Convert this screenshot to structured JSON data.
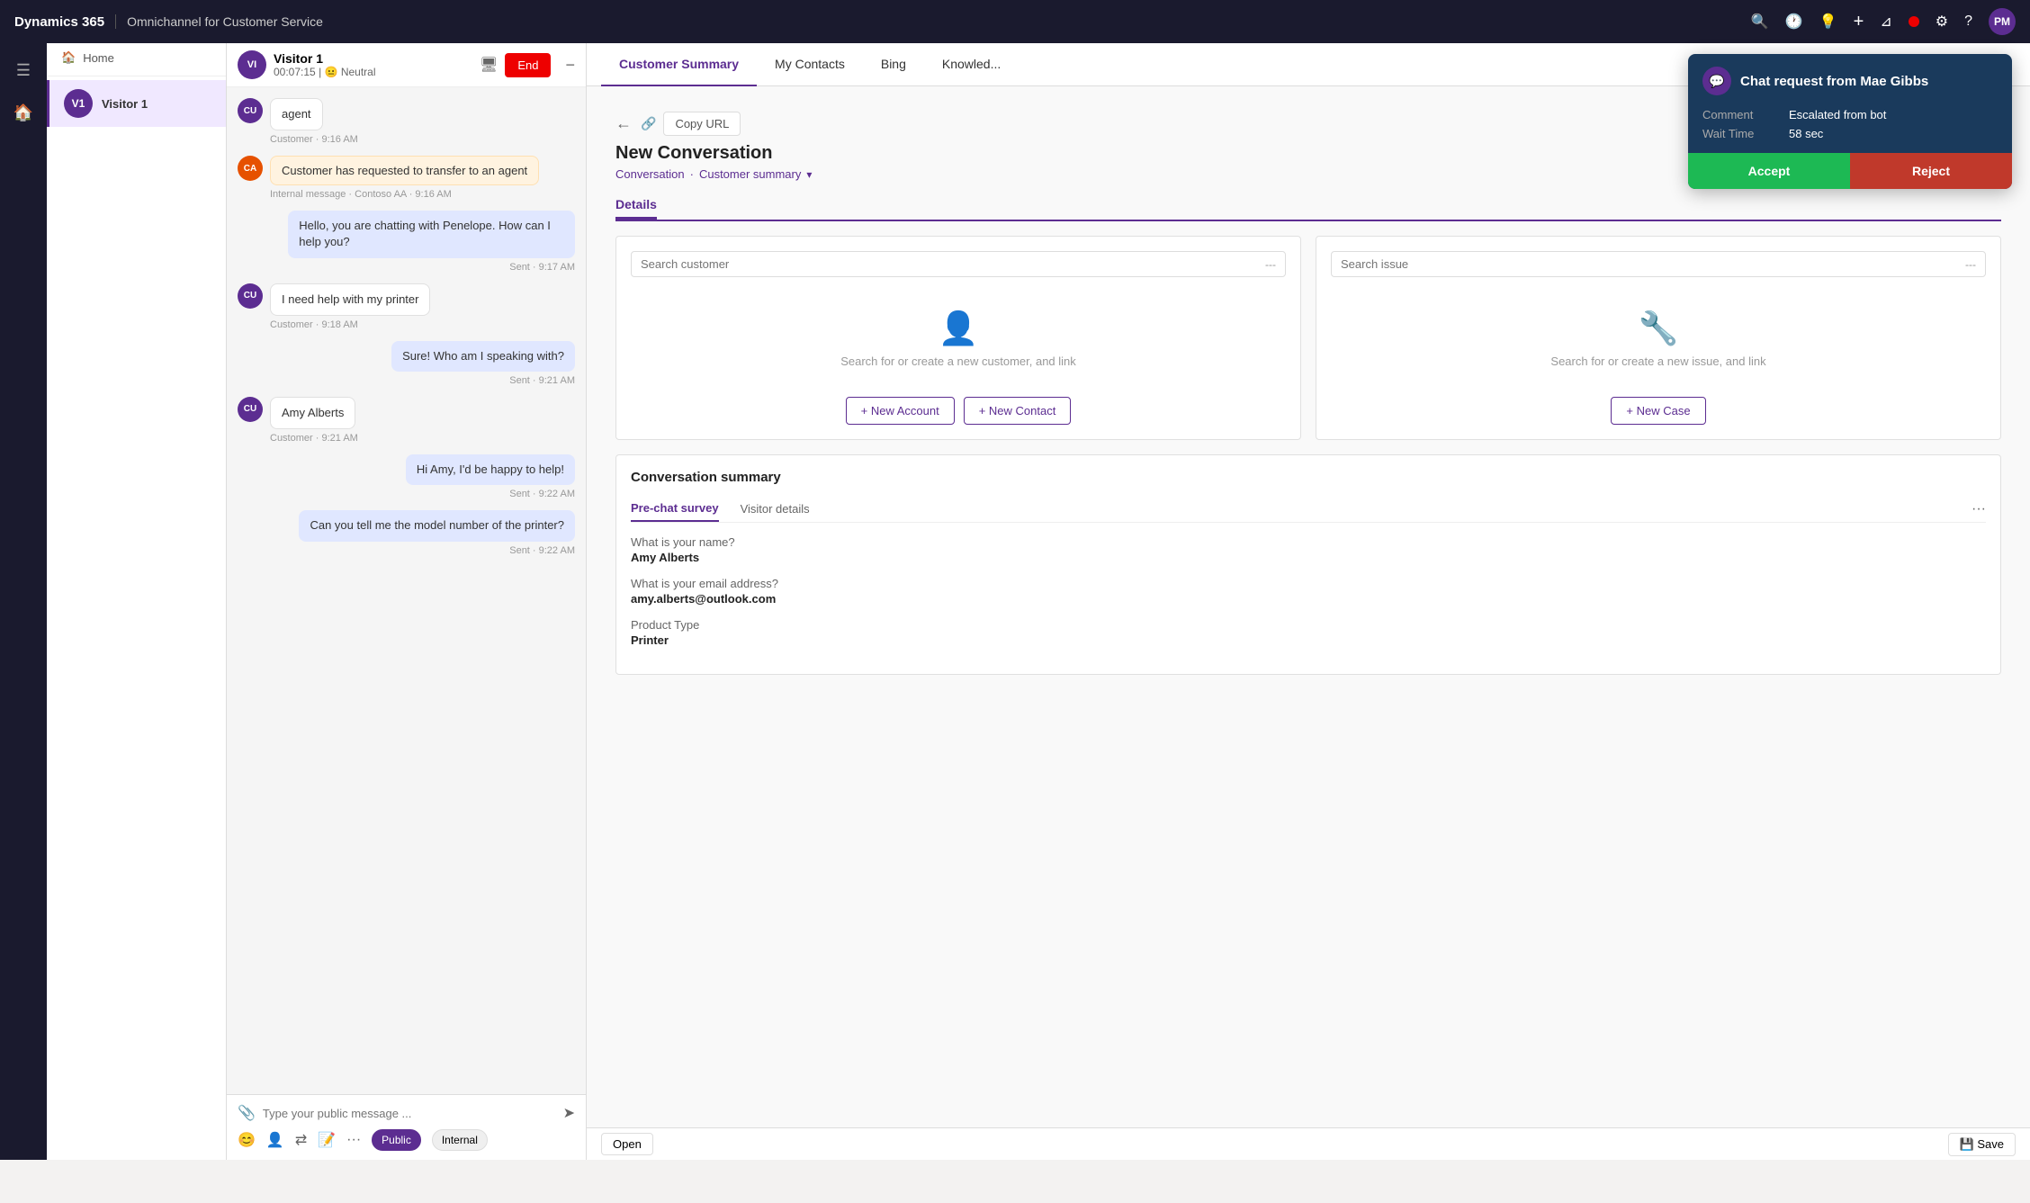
{
  "app": {
    "brand": "Dynamics 365",
    "app_name": "Omnichannel for Customer Service",
    "user_initials": "PM"
  },
  "nav_icons": {
    "search": "🔍",
    "clock": "🕐",
    "lightbulb": "💡",
    "plus": "+",
    "funnel": "⊿",
    "settings": "⚙",
    "help": "?"
  },
  "sidebar": {
    "home_label": "Home"
  },
  "contact_panel": {
    "visitor_name": "Visitor 1"
  },
  "chat": {
    "visitor_label": "Visitor 1",
    "timer": "00:07:15",
    "sentiment": "Neutral",
    "end_button": "End",
    "messages": [
      {
        "id": 1,
        "type": "agent_short",
        "text": "agent",
        "timestamp": "Customer · 9:16 AM",
        "avatar": "CU"
      },
      {
        "id": 2,
        "type": "internal",
        "text": "Customer has requested to transfer to an agent",
        "label": "Internal message · Contoso AA · 9:16 AM",
        "avatar": "CA"
      },
      {
        "id": 3,
        "type": "agent_out",
        "text": "Hello, you are chatting with Penelope. How can I help you?",
        "timestamp": "Sent · 9:17 AM"
      },
      {
        "id": 4,
        "type": "customer",
        "text": "I need help with my printer",
        "timestamp": "Customer · 9:18 AM",
        "avatar": "CU"
      },
      {
        "id": 5,
        "type": "agent_out",
        "text": "Sure! Who am I speaking with?",
        "timestamp": "Sent · 9:21 AM"
      },
      {
        "id": 6,
        "type": "customer",
        "text": "Amy Alberts",
        "timestamp": "Customer · 9:21 AM",
        "avatar": "CU"
      },
      {
        "id": 7,
        "type": "agent_out",
        "text": "Hi Amy, I'd be happy to help!",
        "timestamp": "Sent · 9:22 AM"
      },
      {
        "id": 8,
        "type": "agent_out",
        "text": "Can you tell me the model number of the printer?",
        "timestamp": "Sent · 9:22 AM"
      }
    ],
    "input_placeholder": "Type your public message ...",
    "public_mode": "Public",
    "internal_mode": "Internal"
  },
  "tabs": [
    {
      "id": "customer_summary",
      "label": "Customer Summary",
      "active": true
    },
    {
      "id": "my_contacts",
      "label": "My Contacts",
      "active": false
    },
    {
      "id": "bing",
      "label": "Bing",
      "active": false
    },
    {
      "id": "knowledge",
      "label": "Knowled...",
      "active": false
    }
  ],
  "main": {
    "copy_url_label": "Copy URL",
    "back_icon": "←",
    "conv_title": "New Conversation",
    "breadcrumb_conversation": "Conversation",
    "breadcrumb_sep": "·",
    "breadcrumb_customer_summary": "Customer summary",
    "breadcrumb_chevron": "▾",
    "details_tab": "Details",
    "customer_search": {
      "placeholder": "Search customer",
      "dots": "---",
      "empty_text": "Search for or create a new customer, and link",
      "btn_new_account": "+ New Account",
      "btn_new_contact": "+ New Contact"
    },
    "issue_search": {
      "placeholder": "Search issue",
      "dots": "---",
      "empty_text": "Search for or create a new issue, and link",
      "btn_new_case": "+ New Case"
    },
    "conv_summary": {
      "title": "Conversation summary",
      "tab_pre_chat": "Pre-chat survey",
      "tab_visitor": "Visitor details",
      "tab_more": "···",
      "q1": "What is your name?",
      "a1": "Amy Alberts",
      "q2": "What is your email address?",
      "a2": "amy.alberts@outlook.com",
      "q3": "Product Type",
      "a3": "Printer"
    }
  },
  "notification": {
    "icon": "💬",
    "title": "Chat request from Mae Gibbs",
    "comment_label": "Comment",
    "comment_value": "Escalated from bot",
    "wait_time_label": "Wait Time",
    "wait_time_value": "58 sec",
    "accept_label": "Accept",
    "reject_label": "Reject"
  },
  "bottom_bar": {
    "open_label": "Open",
    "save_label": "💾 Save"
  }
}
